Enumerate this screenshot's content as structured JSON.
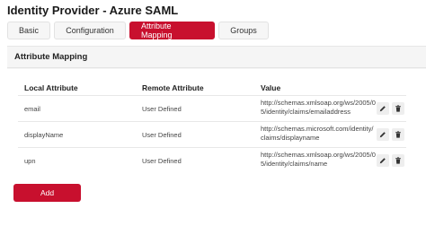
{
  "header": {
    "title": "Identity Provider - Azure SAML"
  },
  "tabs": [
    {
      "label": "Basic"
    },
    {
      "label": "Configuration"
    },
    {
      "label": "Attribute Mapping"
    },
    {
      "label": "Groups"
    }
  ],
  "active_tab": "Attribute Mapping",
  "card": {
    "title": "Attribute Mapping"
  },
  "table": {
    "columns": [
      "Local Attribute",
      "Remote Attribute",
      "Value"
    ],
    "rows": [
      {
        "local": "email",
        "remote": "User Defined",
        "value": "http://schemas.xmlsoap.org/ws/2005/05/identity/claims/emailaddress"
      },
      {
        "local": "displayName",
        "remote": "User Defined",
        "value": "http://schemas.microsoft.com/identity/claims/displayname"
      },
      {
        "local": "upn",
        "remote": "User Defined",
        "value": "http://schemas.xmlsoap.org/ws/2005/05/identity/claims/name"
      }
    ]
  },
  "actions": {
    "add_label": "Add"
  },
  "colors": {
    "accent": "#c8102e",
    "panel": "#f5f5f5"
  },
  "icons": {
    "edit": "pencil-icon",
    "delete": "trash-icon"
  }
}
